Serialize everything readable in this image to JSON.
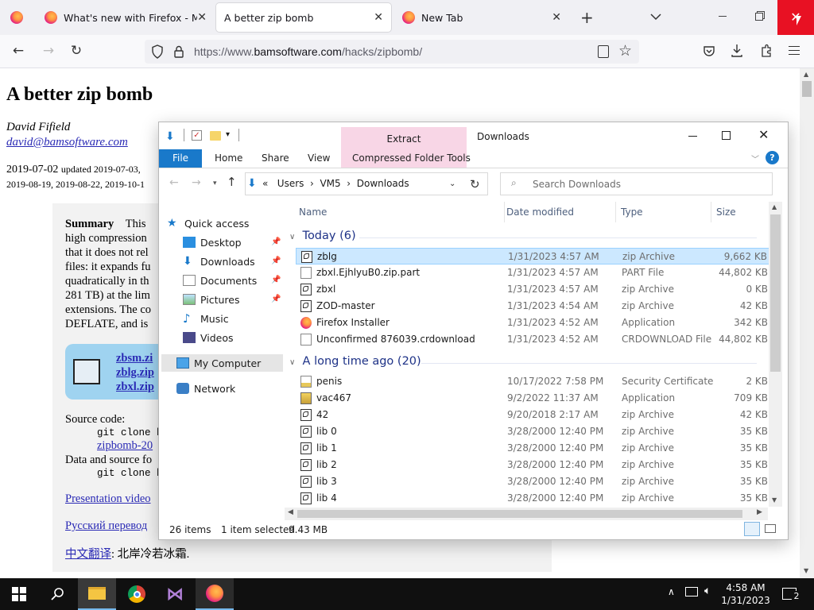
{
  "browser": {
    "tabs": [
      {
        "title": "What's new with Firefox - More"
      },
      {
        "title": "A better zip bomb"
      },
      {
        "title": "New Tab"
      }
    ],
    "url_prefix": "https://www.",
    "url_domain": "bamsoftware.com",
    "url_path": "/hacks/zipbomb/"
  },
  "page": {
    "title": "A better zip bomb",
    "author": "David Fifield",
    "email": "david@bamsoftware.com",
    "date_line1_a": "2019-07-02",
    "date_line1_b": "updated 2019-07-03,",
    "date_line2": "2019-08-19, 2019-08-22, 2019-10-1",
    "summary_bold": "Summary",
    "summary_lines": [
      "This",
      "high compression",
      "that it does not rel",
      "files: it expands fu",
      "quadratically in th",
      "281 TB) at the lim",
      "extensions. The co",
      "DEFLATE, and is"
    ],
    "box_links": [
      "zbsm.zi",
      "zblg.zip",
      "zbxl.zip"
    ],
    "source_label": "Source code:",
    "git1": "git clone h",
    "zipbomb_link": "zipbomb-20",
    "data_label": "Data and source fo",
    "git2": "git clone h",
    "presentation_link": "Presentation video",
    "russian_link": "Русский перевод",
    "chinese_link": "中文翻译",
    "chinese_text": ": 北岸冷若冰霜."
  },
  "explorer": {
    "title": "Downloads",
    "extract_label": "Extract",
    "ribbon_tabs": [
      "File",
      "Home",
      "Share",
      "View",
      "Compressed Folder Tools"
    ],
    "breadcrumb": [
      "«",
      "Users",
      "VM5",
      "Downloads"
    ],
    "search_placeholder": "Search Downloads",
    "nav": [
      {
        "label": "Quick access"
      },
      {
        "label": "Desktop"
      },
      {
        "label": "Downloads"
      },
      {
        "label": "Documents"
      },
      {
        "label": "Pictures"
      },
      {
        "label": "Music"
      },
      {
        "label": "Videos"
      },
      {
        "label": "My Computer"
      },
      {
        "label": "Network"
      }
    ],
    "columns": {
      "name": "Name",
      "date": "Date modified",
      "type": "Type",
      "size": "Size"
    },
    "groups": {
      "today": "Today (6)",
      "old": "A long time ago (20)"
    },
    "files_today": [
      {
        "name": "zblg",
        "date": "1/31/2023 4:57 AM",
        "type": "zip Archive",
        "size": "9,662 KB"
      },
      {
        "name": "zbxl.EjhlyuB0.zip.part",
        "date": "1/31/2023 4:57 AM",
        "type": "PART File",
        "size": "44,802 KB"
      },
      {
        "name": "zbxl",
        "date": "1/31/2023 4:57 AM",
        "type": "zip Archive",
        "size": "0 KB"
      },
      {
        "name": "ZOD-master",
        "date": "1/31/2023 4:54 AM",
        "type": "zip Archive",
        "size": "42 KB"
      },
      {
        "name": "Firefox Installer",
        "date": "1/31/2023 4:52 AM",
        "type": "Application",
        "size": "342 KB"
      },
      {
        "name": "Unconfirmed 876039.crdownload",
        "date": "1/31/2023 4:52 AM",
        "type": "CRDOWNLOAD File",
        "size": "44,802 KB"
      }
    ],
    "files_old": [
      {
        "name": "penis",
        "date": "10/17/2022 7:58 PM",
        "type": "Security Certificate",
        "size": "2 KB"
      },
      {
        "name": "vac467",
        "date": "9/2/2022 11:37 AM",
        "type": "Application",
        "size": "709 KB"
      },
      {
        "name": "42",
        "date": "9/20/2018 2:17 AM",
        "type": "zip Archive",
        "size": "42 KB"
      },
      {
        "name": "lib 0",
        "date": "3/28/2000 12:40 PM",
        "type": "zip Archive",
        "size": "35 KB"
      },
      {
        "name": "lib 1",
        "date": "3/28/2000 12:40 PM",
        "type": "zip Archive",
        "size": "35 KB"
      },
      {
        "name": "lib 2",
        "date": "3/28/2000 12:40 PM",
        "type": "zip Archive",
        "size": "35 KB"
      },
      {
        "name": "lib 3",
        "date": "3/28/2000 12:40 PM",
        "type": "zip Archive",
        "size": "35 KB"
      },
      {
        "name": "lib 4",
        "date": "3/28/2000 12:40 PM",
        "type": "zip Archive",
        "size": "35 KB"
      }
    ],
    "status": {
      "items": "26 items",
      "selected": "1 item selected",
      "size": "9.43 MB"
    }
  },
  "taskbar": {
    "time": "4:58 AM",
    "date": "1/31/2023",
    "notifications": "2"
  },
  "colors": {
    "accent": "#1979ca",
    "close_red": "#e81123",
    "selected_row": "#cce8ff",
    "link": "#2a2ab5"
  }
}
